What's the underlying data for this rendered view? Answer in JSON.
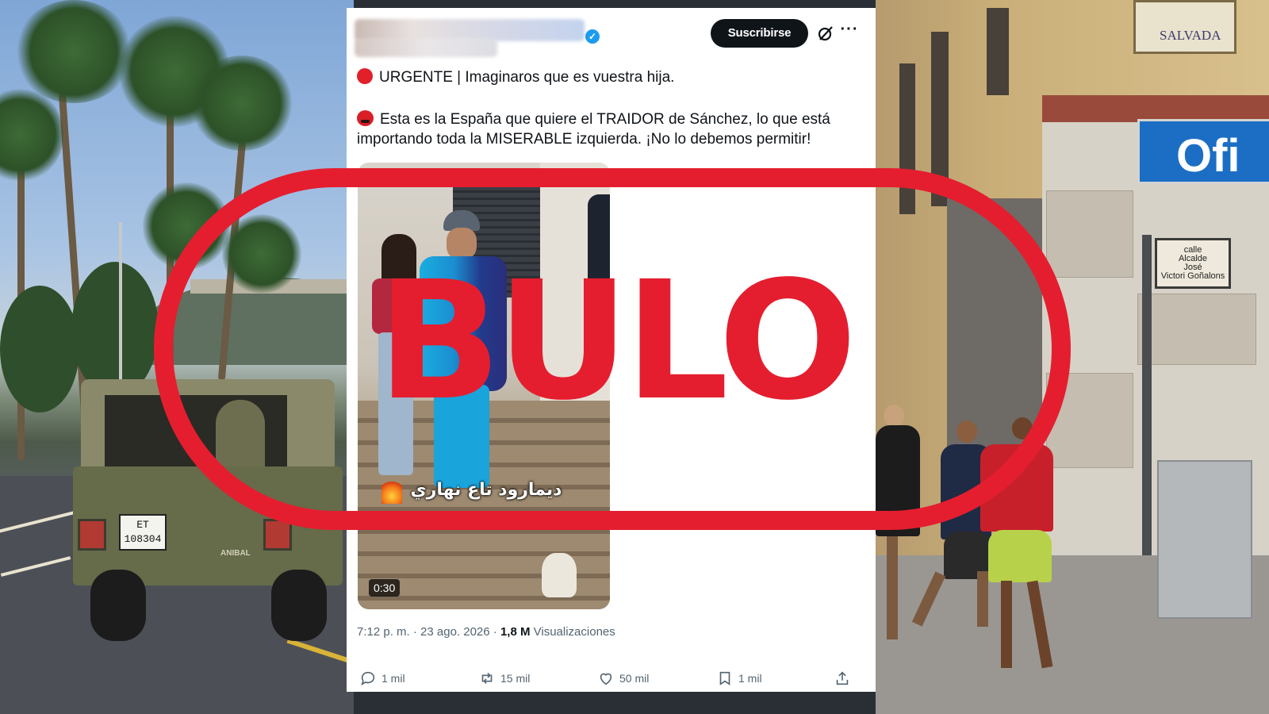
{
  "tweet": {
    "subscribe_label": "Suscribirse",
    "line1": "URGENTE | Imaginaros que es vuestra hija.",
    "line2": "Esta es la España que quiere el TRAIDOR de Sánchez, lo que está",
    "line3": "importando toda la MISERABLE izquierda. ¡No lo debemos permitir!",
    "video": {
      "caption": "ديمارود تاع نهاري",
      "duration": "0:30"
    },
    "meta": {
      "time_date": "7:12 p. m. · 23 ago. 2026 · ",
      "views_count": "1,8 M",
      "views_label": " Visualizaciones"
    },
    "actions": {
      "replies": "1 mil",
      "reposts": "15 mil",
      "likes": "50 mil",
      "bookmarks": "1 mil"
    }
  },
  "stamp": {
    "text": "BULO",
    "color": "#e41e2f"
  },
  "background": {
    "plate_line1": "ET",
    "plate_line2": "108304",
    "jeep_marking": "ANIBAL",
    "street_sign_lines": [
      "calle",
      "Alcalde",
      "José",
      "Victori Goñalons"
    ],
    "tile_sign": "SALVADA",
    "blue_sign": "Ofi"
  },
  "colors": {
    "accent_blue": "#1d9bf0",
    "text_primary": "#0f1419",
    "text_secondary": "#536471"
  },
  "icons": [
    "verified-badge-icon",
    "grok-icon",
    "more-options-icon",
    "reply-icon",
    "repost-icon",
    "like-icon",
    "bookmark-icon",
    "share-icon",
    "red-circle-emoji-icon",
    "angry-face-emoji-icon",
    "fire-emoji-icon"
  ]
}
